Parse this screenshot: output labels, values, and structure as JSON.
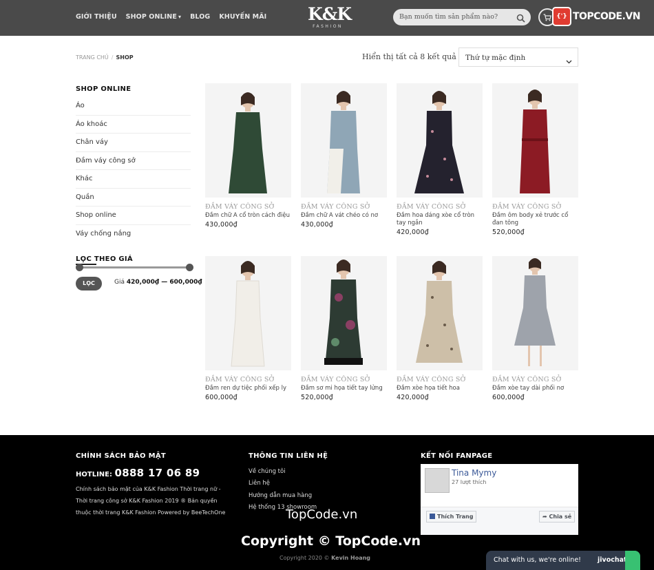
{
  "header": {
    "nav": [
      {
        "label": "GIỚI THIỆU"
      },
      {
        "label": "SHOP ONLINE"
      },
      {
        "label": "BLOG"
      },
      {
        "label": "KHUYẾN MÃI"
      }
    ],
    "logo_mark": "K&K",
    "logo_sub": "FASHION",
    "search_placeholder": "Bạn muốn tìm sản phẩm nào?",
    "watermark_badge": "{'}",
    "watermark_text": "TOPCODE.VN"
  },
  "breadcrumb": {
    "home": "TRANG CHỦ",
    "separator": "/",
    "current": "SHOP"
  },
  "result_count": "Hiển thị tất cả 8 kết quả",
  "sort_value": "Thứ tự mặc định",
  "sidebar": {
    "title": "SHOP ONLINE",
    "categories": [
      "Áo",
      "Áo khoác",
      "Chân váy",
      "Đầm váy công sở",
      "Khác",
      "Quần",
      "Shop online",
      "Váy chống nắng"
    ],
    "filter_title": "LỌC THEO GIÁ",
    "filter_button": "LỌC",
    "price_label": "Giá",
    "price_range": "420,000₫ — 600,000₫"
  },
  "products": [
    {
      "category": "ĐẦM VÁY CÔNG SỞ",
      "name": "Đầm chữ A cổ tròn cách điệu",
      "price": "430,000₫",
      "color": "#2f4a36"
    },
    {
      "category": "ĐẦM VÁY CÔNG SỞ",
      "name": "Đầm chữ A vát chéo có nơ",
      "price": "430,000₫",
      "color": "#8fa6b6"
    },
    {
      "category": "ĐẦM VÁY CÔNG SỞ",
      "name": "Đầm hoa dáng xòe cổ tròn tay ngắn",
      "price": "420,000₫",
      "color": "#24222e"
    },
    {
      "category": "ĐẦM VÁY CÔNG SỞ",
      "name": "Đầm ôm body xẻ trước cổ đan tông",
      "price": "520,000₫",
      "color": "#8c1b24"
    },
    {
      "category": "ĐẦM VÁY CÔNG SỞ",
      "name": "Đầm ren dự tiệc phối xếp ly",
      "price": "600,000₫",
      "color": "#f1eee8"
    },
    {
      "category": "ĐẦM VÁY CÔNG SỞ",
      "name": "Đầm sơ mi họa tiết tay lửng",
      "price": "520,000₫",
      "color": "#2d3b33"
    },
    {
      "category": "ĐẦM VÁY CÔNG SỞ",
      "name": "Đầm xòe họa tiết hoa",
      "price": "420,000₫",
      "color": "#cdbfa8"
    },
    {
      "category": "ĐẦM VÁY CÔNG SỞ",
      "name": "Đầm xòe tay dài phối nơ",
      "price": "600,000₫",
      "color": "#9ea3ab"
    }
  ],
  "footer": {
    "policy_title": "CHÍNH SÁCH BẢO MẬT",
    "hotline_label": "HOTLINE:",
    "hotline_number": "0888 17 06 89",
    "policy_text": "Chính sách bảo mật của K&K Fashion Thời trang nữ - Thời trang công sở K&K Fashion 2019 ® Bản quyền thuộc thời trang K&K Fashion Powered by BeeTechOne",
    "contact_title": "THÔNG TIN LIÊN HỆ",
    "contact_links": [
      "Về chúng tôi",
      "Liên hệ",
      "Hướng dẫn mua hàng",
      "Hệ thống 13 showroom"
    ],
    "fanpage_title": "KẾT NỐI FANPAGE",
    "fb_name": "Tina Mymy",
    "fb_likes": "27 lượt thích",
    "fb_like_button": "Thích Trang",
    "fb_share_button": "Chia sẻ",
    "watermark_1": "TopCode.vn",
    "watermark_2": "Copyright © TopCode.vn",
    "copyright_prefix": "Copyright 2020 ©",
    "copyright_name": "Kevin Hoang"
  },
  "chat": {
    "text": "Chat with us, we're online!",
    "brand": "jivochat"
  }
}
